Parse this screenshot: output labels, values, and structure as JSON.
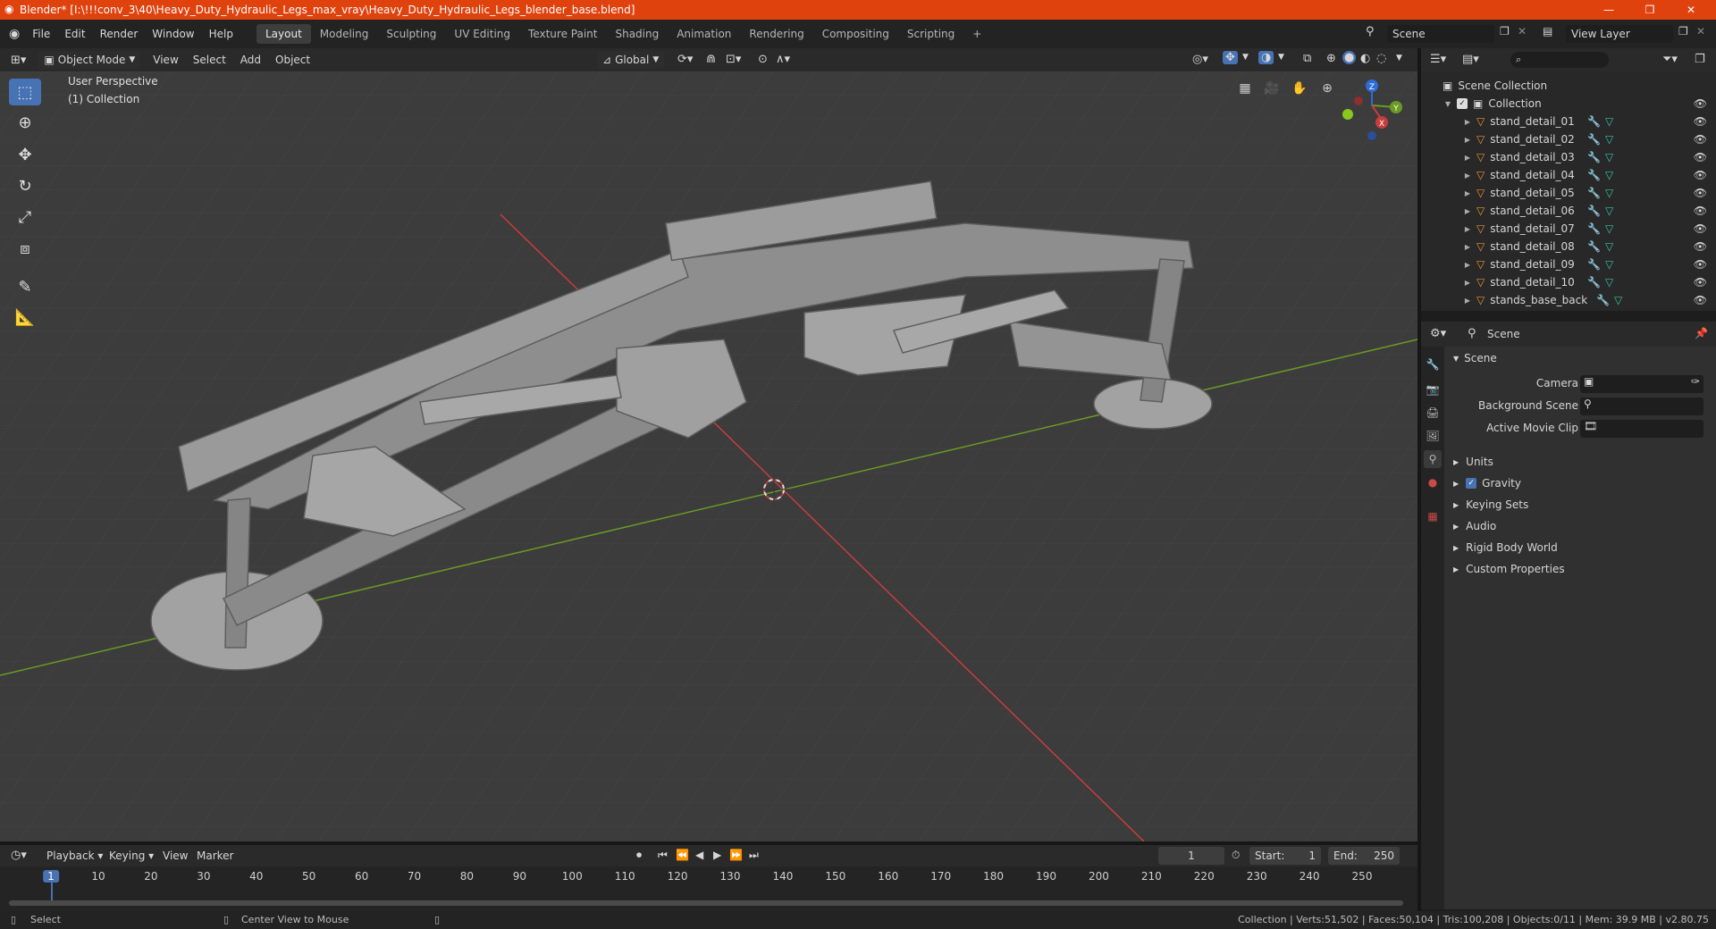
{
  "titlebar": {
    "title": "Blender* [I:\\!!!conv_3\\40\\Heavy_Duty_Hydraulic_Legs_max_vray\\Heavy_Duty_Hydraulic_Legs_blender_base.blend]",
    "minimize": "—",
    "maximize": "❐",
    "close": "✕"
  },
  "menubar": {
    "menus": [
      "File",
      "Edit",
      "Render",
      "Window",
      "Help"
    ],
    "workspaces": [
      "Layout",
      "Modeling",
      "Sculpting",
      "UV Editing",
      "Texture Paint",
      "Shading",
      "Animation",
      "Rendering",
      "Compositing",
      "Scripting"
    ],
    "add_workspace": "+",
    "scene": "Scene",
    "view_layer": "View Layer"
  },
  "viewport_header": {
    "mode": "Object Mode",
    "menus": [
      "View",
      "Select",
      "Add",
      "Object"
    ],
    "transform_orientation": "Global"
  },
  "viewport": {
    "perspective": "User Perspective",
    "collection": "(1) Collection",
    "gizmo": {
      "x": "X",
      "y": "Y",
      "z": "Z"
    }
  },
  "outliner": {
    "root": "Scene Collection",
    "collection": "Collection",
    "objects": [
      "stand_detail_01",
      "stand_detail_02",
      "stand_detail_03",
      "stand_detail_04",
      "stand_detail_05",
      "stand_detail_06",
      "stand_detail_07",
      "stand_detail_08",
      "stand_detail_09",
      "stand_detail_10",
      "stands_base_back"
    ]
  },
  "properties": {
    "header": "Scene",
    "panel": "Scene",
    "fields": [
      {
        "label": "Camera",
        "value": ""
      },
      {
        "label": "Background Scene",
        "value": ""
      },
      {
        "label": "Active Movie Clip",
        "value": ""
      }
    ],
    "sections": [
      "Units",
      "Gravity",
      "Keying Sets",
      "Audio",
      "Rigid Body World",
      "Custom Properties"
    ],
    "gravity_enabled": true
  },
  "timeline": {
    "menus": [
      "Playback",
      "Keying",
      "View",
      "Marker"
    ],
    "current_frame": "1",
    "start_label": "Start:",
    "start": "1",
    "end_label": "End:",
    "end": "250",
    "ticks": [
      "1",
      "10",
      "20",
      "30",
      "40",
      "50",
      "60",
      "70",
      "80",
      "90",
      "100",
      "110",
      "120",
      "130",
      "140",
      "150",
      "160",
      "170",
      "180",
      "190",
      "200",
      "210",
      "220",
      "230",
      "240",
      "250"
    ]
  },
  "statusbar": {
    "select": "Select",
    "center_view": "Center View to Mouse",
    "stats": "Collection | Verts:51,502 | Faces:50,104 | Tris:100,208 | Objects:0/11 | Mem: 39.9 MB | v2.80.75"
  },
  "colors": {
    "titlebar": "#e0420e",
    "accent": "#4772b3",
    "x_axis": "#c83c3c",
    "y_axis": "#6a9a24",
    "object_icon": "#e8913a",
    "mesh_icon": "#35c4a0"
  }
}
